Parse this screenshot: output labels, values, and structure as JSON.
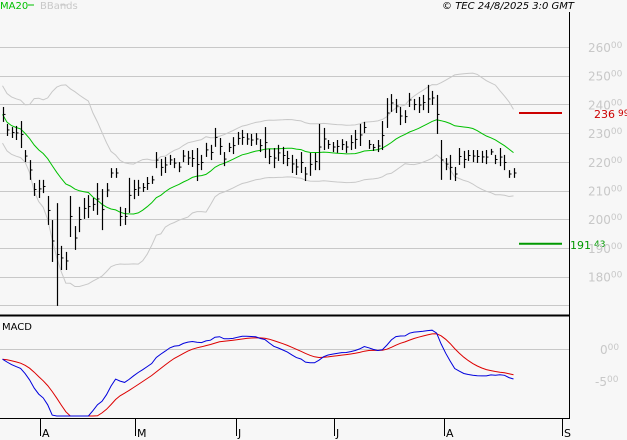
{
  "header": {
    "legend": [
      {
        "label": "MA20",
        "color": "#00c000"
      },
      {
        "label": "BBands",
        "color": "#c8c8c8"
      }
    ],
    "copyright": "© TEC 24/8/2025 3:0 GMT"
  },
  "chart_data": [
    {
      "type": "ohlc",
      "title": "",
      "ylim": [
        165,
        270
      ],
      "grid": true,
      "y_ticks": [
        {
          "int": "260",
          "dec": "00",
          "value": 260
        },
        {
          "int": "250",
          "dec": "00",
          "value": 250
        },
        {
          "int": "240",
          "dec": "00",
          "value": 240
        },
        {
          "int": "230",
          "dec": "00",
          "value": 230
        },
        {
          "int": "220",
          "dec": "00",
          "value": 220
        },
        {
          "int": "210",
          "dec": "00",
          "value": 210
        },
        {
          "int": "200",
          "dec": "00",
          "value": 200
        },
        {
          "int": "190",
          "dec": "00",
          "value": 190
        },
        {
          "int": "180",
          "dec": "00",
          "value": 180
        }
      ],
      "x_ticks": [
        "A",
        "M",
        "J",
        "J",
        "A",
        "S"
      ],
      "bars_high_low": [
        [
          239.1,
          233.9
        ],
        [
          233.2,
          229.0
        ],
        [
          232.1,
          228.3
        ],
        [
          232.5,
          227.6
        ],
        [
          234.2,
          224.8
        ],
        [
          224.1,
          219.9
        ],
        [
          220.6,
          213.7
        ],
        [
          212.6,
          208.1
        ],
        [
          213.7,
          207.4
        ],
        [
          213.7,
          209.1
        ],
        [
          208.1,
          198.0
        ],
        [
          199.7,
          185.1
        ],
        [
          205.6,
          169.8
        ],
        [
          190.7,
          182.3
        ],
        [
          188.6,
          182.3
        ],
        [
          208.1,
          193.8
        ],
        [
          197.6,
          189.3
        ],
        [
          204.3,
          195.5
        ],
        [
          207.4,
          200.1
        ],
        [
          208.4,
          200.4
        ],
        [
          207.4,
          202.9
        ],
        [
          212.6,
          201.5
        ],
        [
          210.5,
          196.2
        ],
        [
          212.6,
          207.7
        ],
        [
          217.8,
          214.4
        ],
        [
          217.8,
          214.4
        ],
        [
          204.3,
          197.6
        ],
        [
          203.9,
          198.0
        ],
        [
          214.4,
          202.2
        ],
        [
          213.7,
          207.0
        ],
        [
          213.7,
          208.1
        ],
        [
          212.6,
          209.5
        ],
        [
          214.7,
          210.2
        ],
        [
          215.1,
          212.3
        ],
        [
          223.4,
          217.8
        ],
        [
          221.0,
          215.1
        ],
        [
          221.7,
          216.1
        ],
        [
          222.4,
          218.9
        ],
        [
          221.3,
          217.8
        ],
        [
          219.9,
          216.4
        ],
        [
          224.1,
          219.9
        ],
        [
          223.8,
          218.9
        ],
        [
          224.1,
          218.2
        ],
        [
          224.8,
          213.3
        ],
        [
          222.4,
          217.1
        ],
        [
          226.6,
          221.7
        ],
        [
          225.9,
          220.6
        ],
        [
          231.8,
          225.2
        ],
        [
          228.3,
          222.4
        ],
        [
          223.4,
          218.5
        ],
        [
          226.6,
          223.4
        ],
        [
          228.6,
          222.7
        ],
        [
          230.4,
          225.9
        ],
        [
          231.1,
          225.9
        ],
        [
          230.0,
          225.9
        ],
        [
          229.7,
          225.5
        ],
        [
          230.0,
          225.9
        ],
        [
          227.9,
          223.4
        ],
        [
          232.1,
          221.3
        ],
        [
          224.5,
          219.2
        ],
        [
          224.8,
          217.8
        ],
        [
          225.9,
          220.3
        ],
        [
          225.2,
          219.2
        ],
        [
          223.8,
          218.5
        ],
        [
          222.4,
          216.1
        ],
        [
          221.0,
          215.4
        ],
        [
          223.4,
          216.1
        ],
        [
          218.2,
          213.3
        ],
        [
          223.1,
          215.1
        ],
        [
          223.1,
          217.1
        ],
        [
          233.2,
          217.1
        ],
        [
          231.8,
          224.1
        ],
        [
          227.6,
          224.5
        ],
        [
          226.9,
          223.4
        ],
        [
          227.6,
          223.1
        ],
        [
          227.9,
          224.1
        ],
        [
          227.2,
          223.1
        ],
        [
          229.3,
          224.1
        ],
        [
          231.1,
          224.5
        ],
        [
          233.2,
          225.5
        ],
        [
          233.9,
          230.0
        ],
        [
          227.6,
          224.5
        ],
        [
          226.2,
          223.8
        ],
        [
          227.6,
          223.4
        ],
        [
          234.2,
          224.1
        ],
        [
          242.2,
          231.8
        ],
        [
          243.6,
          237.4
        ],
        [
          241.9,
          237.0
        ],
        [
          239.1,
          232.8
        ],
        [
          238.0,
          233.5
        ],
        [
          244.0,
          239.1
        ],
        [
          241.9,
          238.0
        ],
        [
          242.6,
          237.0
        ],
        [
          243.3,
          238.0
        ],
        [
          246.8,
          237.0
        ],
        [
          244.7,
          239.8
        ],
        [
          243.3,
          229.7
        ],
        [
          227.6,
          213.7
        ],
        [
          221.3,
          217.1
        ],
        [
          222.4,
          213.7
        ],
        [
          218.2,
          213.3
        ],
        [
          224.8,
          218.9
        ],
        [
          223.8,
          217.8
        ],
        [
          224.1,
          220.3
        ],
        [
          224.1,
          219.9
        ],
        [
          224.1,
          219.6
        ],
        [
          223.8,
          219.6
        ],
        [
          224.1,
          219.2
        ],
        [
          224.5,
          222.4
        ],
        [
          222.4,
          219.2
        ],
        [
          224.8,
          218.5
        ],
        [
          222.4,
          217.1
        ],
        [
          217.1,
          214.4
        ],
        [
          217.8,
          214.4
        ]
      ],
      "levels": [
        {
          "label_int": "236",
          "label_dec": "99",
          "value": 236.99,
          "color": "#cc0000"
        },
        {
          "label_int": "191",
          "label_dec": "43",
          "value": 191.43,
          "color": "#009900"
        }
      ]
    },
    {
      "type": "line",
      "title": "MACD",
      "ylim": [
        -11,
        5
      ],
      "y_ticks": [
        {
          "int": "0",
          "dec": "00",
          "value": 0
        },
        {
          "int": "-5",
          "dec": "00",
          "value": -5
        }
      ],
      "series_colors": {
        "macd": "#0000dd",
        "signal": "#dd0000"
      }
    }
  ]
}
